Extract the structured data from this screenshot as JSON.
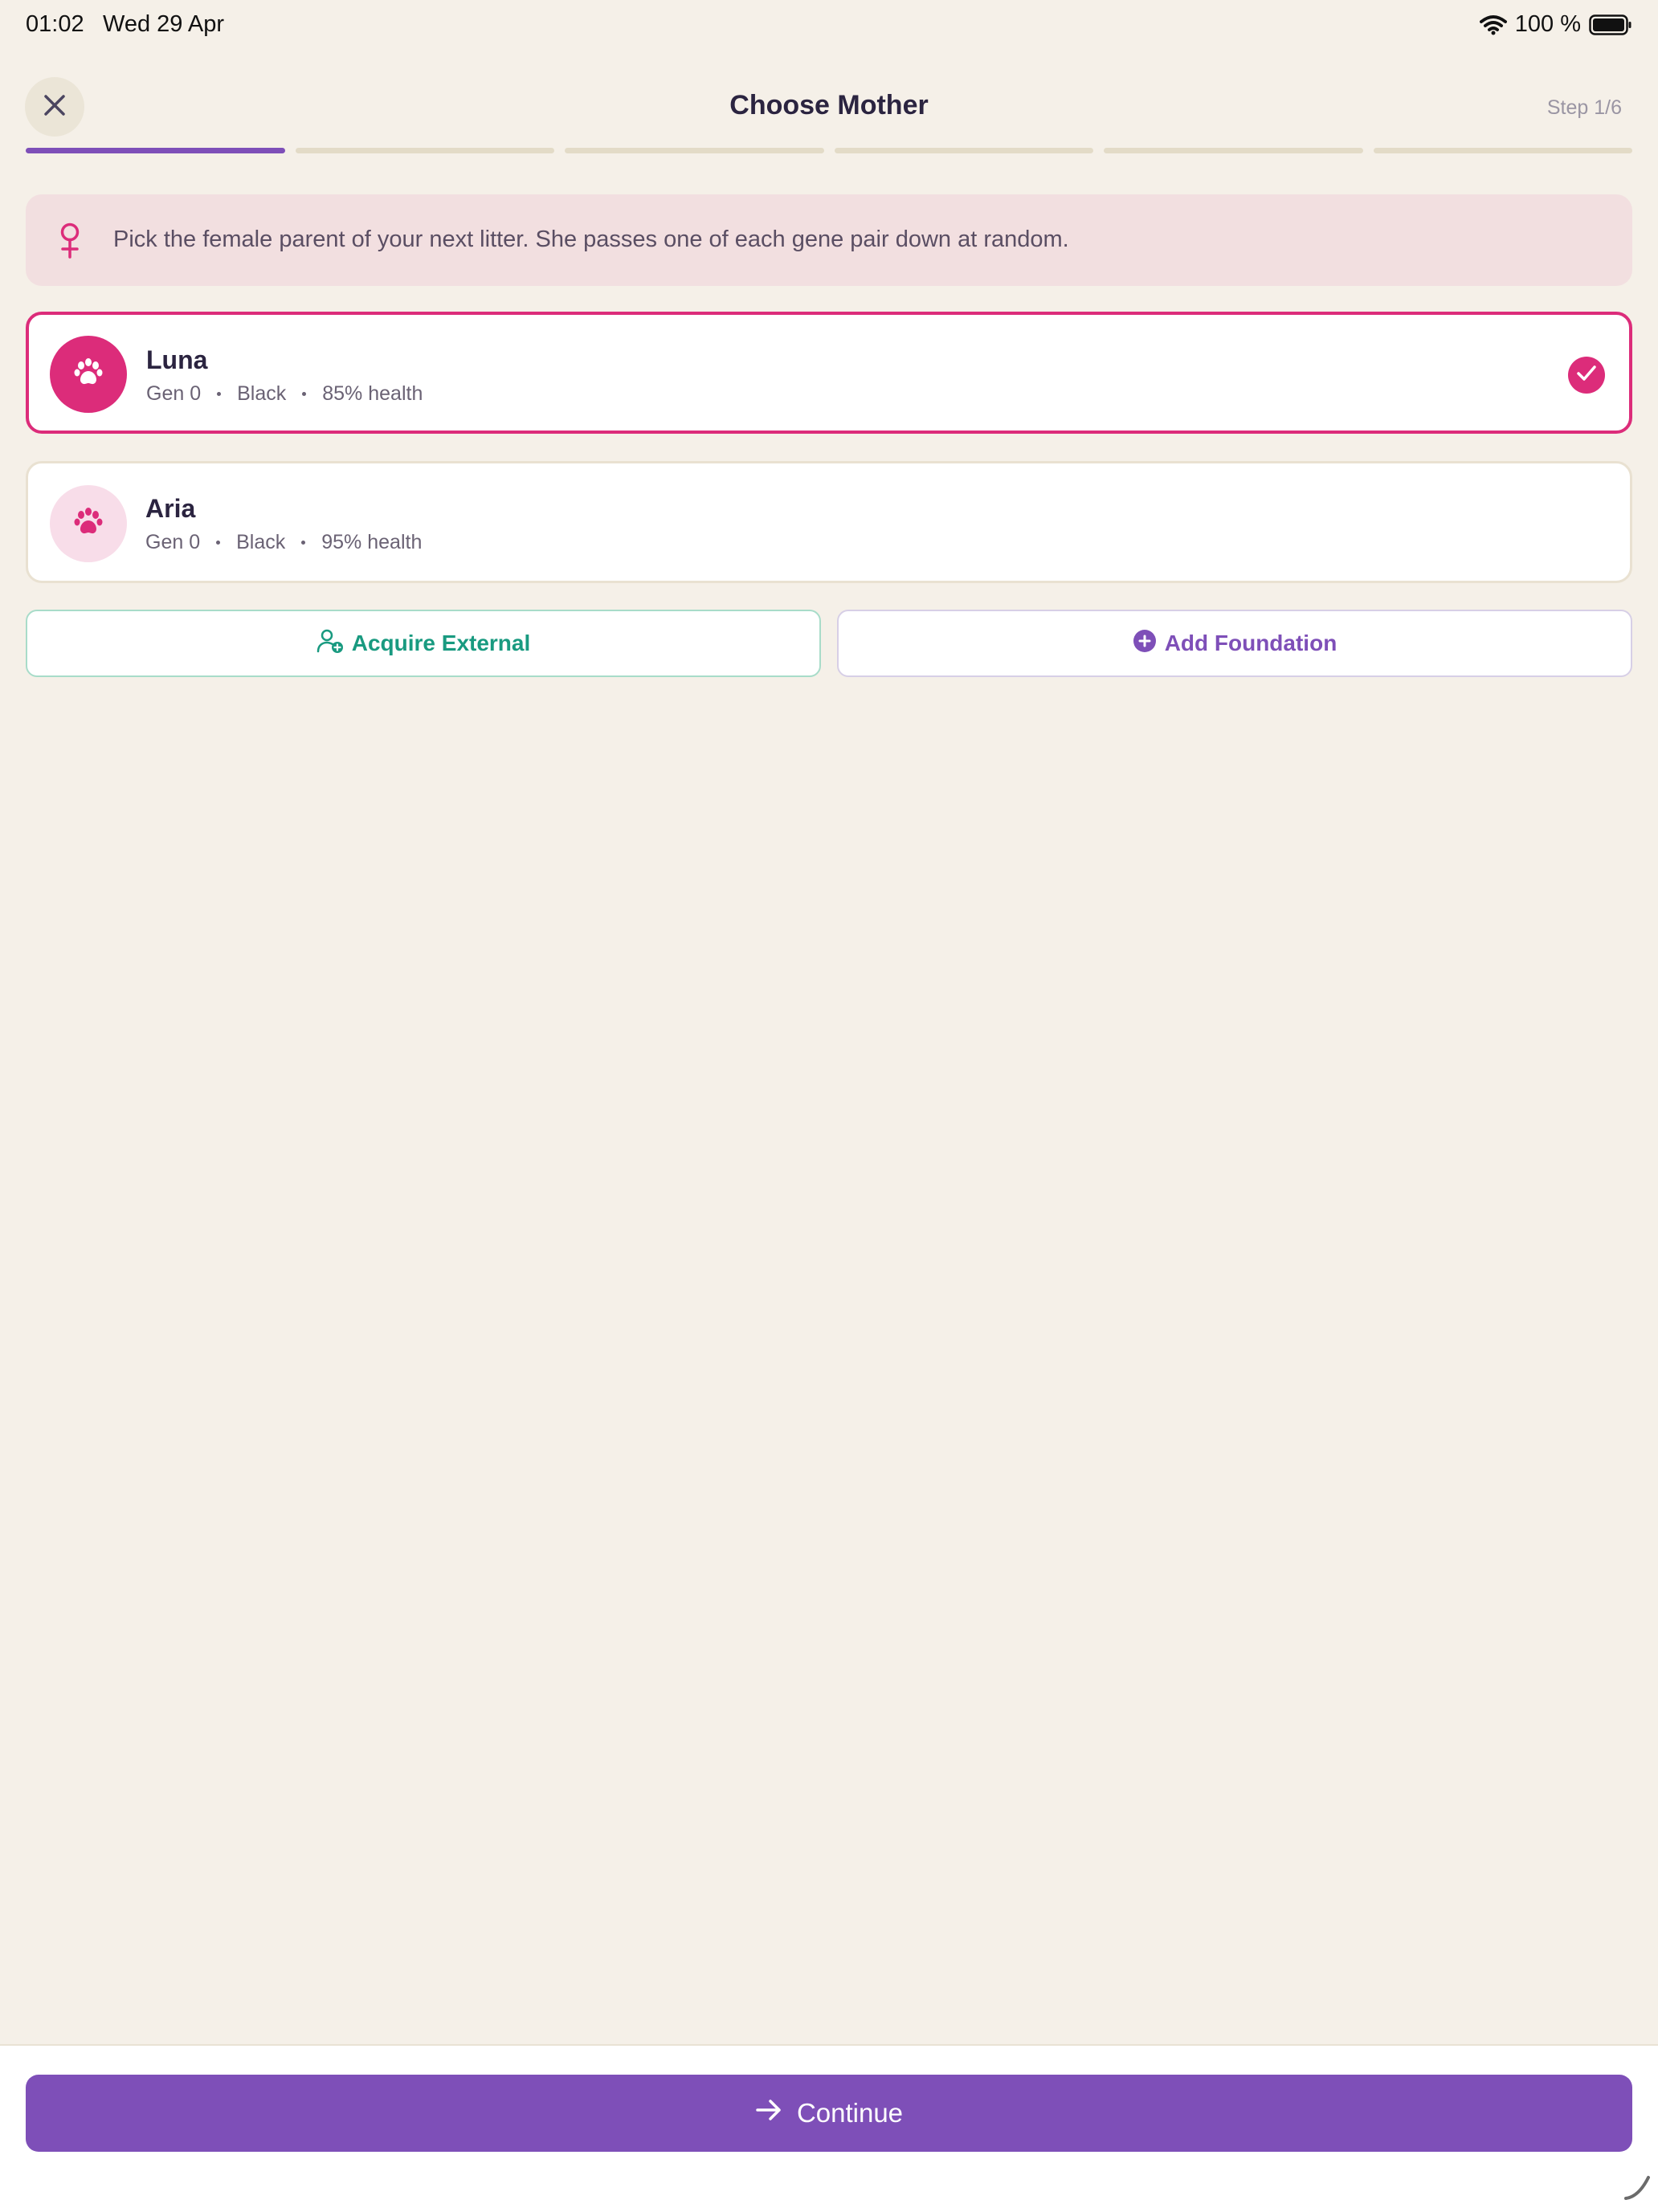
{
  "status": {
    "time": "01:02",
    "date": "Wed 29 Apr",
    "battery": "100 %"
  },
  "header": {
    "title": "Choose Mother",
    "step": "Step 1/6",
    "progress_current": 1,
    "progress_total": 6
  },
  "info": {
    "text": "Pick the female parent of your next litter. She passes one of each gene pair down at random."
  },
  "cats": [
    {
      "name": "Luna",
      "gen": "Gen 0",
      "color": "Black",
      "health": "85% health",
      "selected": true
    },
    {
      "name": "Aria",
      "gen": "Gen 0",
      "color": "Black",
      "health": "95% health",
      "selected": false
    }
  ],
  "actions": {
    "acquire_label": "Acquire External",
    "foundation_label": "Add Foundation"
  },
  "footer": {
    "continue_label": "Continue"
  },
  "colors": {
    "accent_purple": "#7e4fb8",
    "accent_pink": "#dc2c7a",
    "accent_teal": "#199a80",
    "background": "#f5f0e8"
  },
  "icons": [
    "close-icon",
    "female-icon",
    "paw-icon",
    "check-icon",
    "add-user-icon",
    "plus-circle-icon",
    "arrow-right-icon",
    "wifi-icon",
    "battery-icon"
  ]
}
